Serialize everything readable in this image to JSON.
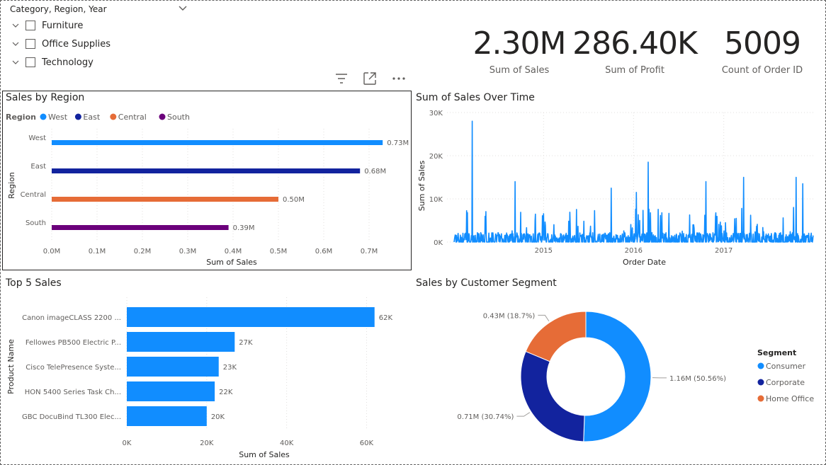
{
  "slicer": {
    "title": "Category, Region, Year",
    "items": [
      {
        "label": "Furniture"
      },
      {
        "label": "Office Supplies"
      },
      {
        "label": "Technology"
      }
    ]
  },
  "kpis": [
    {
      "value": "2.30M",
      "label": "Sum of Sales"
    },
    {
      "value": "286.40K",
      "label": "Sum of Profit"
    },
    {
      "value": "5009",
      "label": "Count of Order ID"
    }
  ],
  "visual_header_icons": [
    "filter-icon",
    "focus-mode-icon",
    "more-options-icon"
  ],
  "colors": {
    "west": "#118DFF",
    "east": "#12239E",
    "central": "#E66C37",
    "south": "#6B007B",
    "bar": "#118DFF",
    "consumer": "#118DFF",
    "corporate": "#12239E",
    "home_office": "#E66C37"
  },
  "sales_by_region": {
    "title": "Sales by Region",
    "legend_title": "Region",
    "xlabel": "Sum of Sales",
    "ylabel": "Region",
    "legend_position": "top-left"
  },
  "sales_over_time": {
    "title": "Sum of Sales Over Time",
    "xlabel": "Order Date",
    "ylabel": "Sum of Sales"
  },
  "top5": {
    "title": "Top 5 Sales",
    "xlabel": "Sum of Sales",
    "ylabel": "Product Name"
  },
  "segment": {
    "title": "Sales by Customer Segment",
    "legend_title": "Segment",
    "legend_position": "right"
  },
  "chart_data": [
    {
      "type": "bar",
      "orientation": "horizontal",
      "title": "Sales by Region",
      "categories": [
        "West",
        "East",
        "Central",
        "South"
      ],
      "values": [
        0.73,
        0.68,
        0.5,
        0.39
      ],
      "data_labels": [
        "0.73M",
        "0.68M",
        "0.50M",
        "0.39M"
      ],
      "xlabel": "Sum of Sales",
      "ylabel": "Region",
      "xlim": [
        0,
        0.75
      ],
      "x_ticks": [
        "0.0M",
        "0.1M",
        "0.2M",
        "0.3M",
        "0.4M",
        "0.5M",
        "0.6M",
        "0.7M"
      ],
      "legend": [
        "West",
        "East",
        "Central",
        "South"
      ],
      "grid": true
    },
    {
      "type": "line",
      "title": "Sum of Sales Over Time",
      "xlabel": "Order Date",
      "ylabel": "Sum of Sales",
      "ylim": [
        0,
        30000
      ],
      "y_ticks": [
        "0K",
        "10K",
        "20K",
        "30K"
      ],
      "x_ticks": [
        "2015",
        "2016",
        "2017"
      ],
      "x_range": [
        "2014-01-03",
        "2017-12-30"
      ],
      "notable_peaks": [
        {
          "x": "2014-03-18",
          "y": 28000
        },
        {
          "x": "2014-09-08",
          "y": 14000
        },
        {
          "x": "2015-10-02",
          "y": 12500
        },
        {
          "x": "2016-01-12",
          "y": 11500
        },
        {
          "x": "2016-03-01",
          "y": 18500
        },
        {
          "x": "2016-10-20",
          "y": 14000
        },
        {
          "x": "2017-03-23",
          "y": 15000
        },
        {
          "x": "2017-10-22",
          "y": 15000
        },
        {
          "x": "2017-11-17",
          "y": 13500
        }
      ],
      "grid": true
    },
    {
      "type": "bar",
      "orientation": "horizontal",
      "title": "Top 5 Sales",
      "categories": [
        "Canon imageCLASS 2200 ...",
        "Fellowes PB500 Electric P...",
        "Cisco TelePresence Syste...",
        "HON 5400 Series Task Ch...",
        "GBC DocuBind TL300 Elec..."
      ],
      "values": [
        62000,
        27000,
        23000,
        22000,
        20000
      ],
      "data_labels": [
        "62K",
        "27K",
        "23K",
        "22K",
        "20K"
      ],
      "xlabel": "Sum of Sales",
      "ylabel": "Product Name",
      "xlim": [
        0,
        64000
      ],
      "x_ticks": [
        "0K",
        "20K",
        "40K",
        "60K"
      ],
      "grid": true
    },
    {
      "type": "pie",
      "variant": "donut",
      "title": "Sales by Customer Segment",
      "categories": [
        "Consumer",
        "Corporate",
        "Home Office"
      ],
      "values": [
        50.56,
        30.74,
        18.7
      ],
      "data_labels": [
        "1.16M (50.56%)",
        "0.71M (30.74%)",
        "0.43M (18.7%)"
      ],
      "legend": [
        "Consumer",
        "Corporate",
        "Home Office"
      ],
      "legend_title": "Segment"
    }
  ]
}
